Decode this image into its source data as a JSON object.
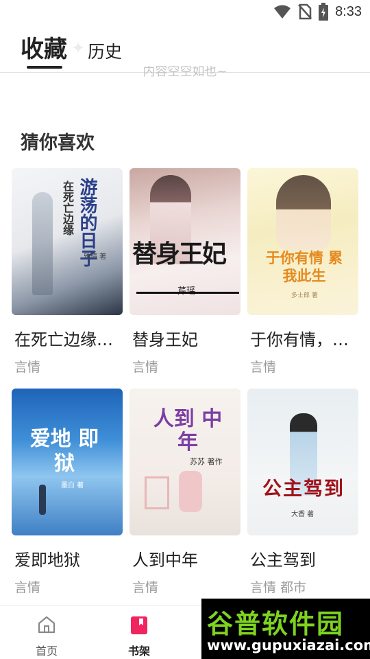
{
  "status_bar": {
    "time": "8:33"
  },
  "tabs": {
    "favorites": "收藏",
    "history": "历史"
  },
  "empty_hint": "内容空空如也~",
  "section": {
    "title": "猜你喜欢"
  },
  "books": [
    {
      "title": "在死亡边缘…",
      "tags": "言情",
      "cover_text": "游荡的日子",
      "cover_sub": "在死亡边缘",
      "cover_author": "雅晴 著"
    },
    {
      "title": "替身王妃",
      "tags": "言情",
      "cover_text": "替身王妃",
      "cover_author": "芹瑶"
    },
    {
      "title": "于你有情，…",
      "tags": "言情",
      "cover_text": "于你有情 累我此生",
      "cover_author": "多士郎 著"
    },
    {
      "title": "爱即地狱",
      "tags": "言情",
      "cover_text": "爱地 即狱",
      "cover_author": "墨白 著"
    },
    {
      "title": "人到中年",
      "tags": "言情",
      "cover_text": "人到 中年",
      "cover_author": "苏苏 著作"
    },
    {
      "title": "公主驾到",
      "tags": "言情 都市",
      "cover_text": "公主驾到",
      "cover_author": "大香 著"
    }
  ],
  "bottom_nav": [
    {
      "label": "首页",
      "icon": "home-icon",
      "active": false
    },
    {
      "label": "书架",
      "icon": "bookshelf-icon",
      "active": true
    }
  ],
  "watermark": {
    "line1": "谷普软件园",
    "line2": "www.gupuxiazai.com"
  },
  "colors": {
    "accent": "#f0245e",
    "watermark_green": "#7ed320"
  }
}
